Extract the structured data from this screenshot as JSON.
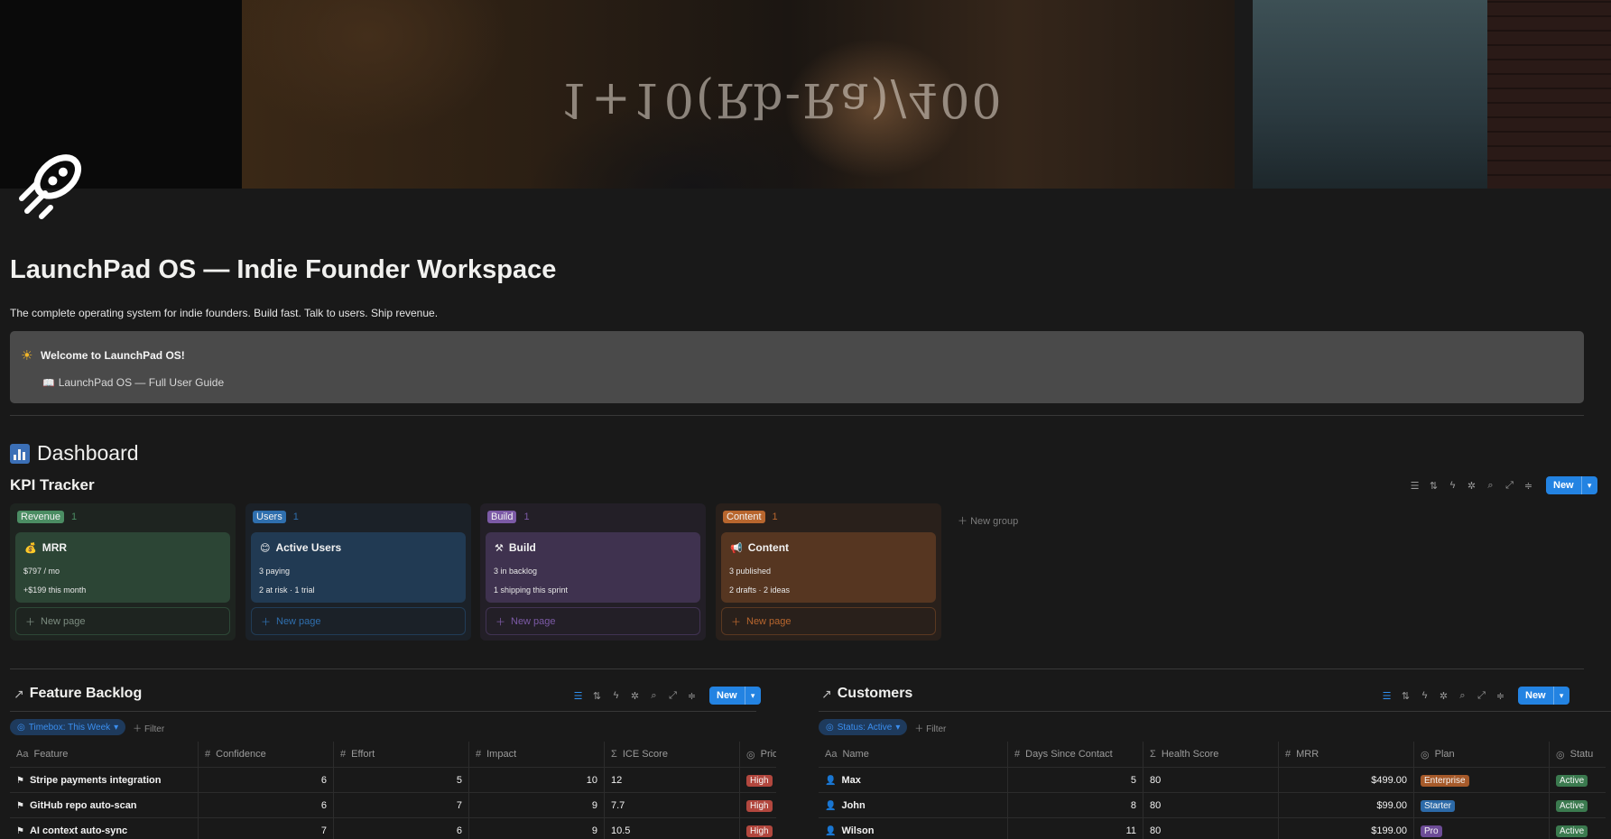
{
  "page": {
    "title": "LaunchPad OS — Indie Founder Workspace",
    "subtitle": "The complete operating system for indie founders. Build fast. Talk to users. Ship revenue.",
    "icon": "rocket-icon"
  },
  "cover": {
    "equation": "1+10(Rb-Ra)/400"
  },
  "callout": {
    "icon": "sun-icon",
    "title": "Welcome to LaunchPad OS!",
    "link_icon": "book-icon",
    "link_text": "LaunchPad OS — Full User Guide"
  },
  "dashboard": {
    "heading": "Dashboard",
    "icon": "bar-chart-icon"
  },
  "kpi": {
    "title": "KPI Tracker",
    "new_label": "New",
    "new_group_label": "New group",
    "columns": [
      {
        "tag": "Revenue",
        "count": "1",
        "accent": "#4b8d63",
        "card_icon": "money-bag-icon",
        "card_glyph": "💰",
        "card_title": "MRR",
        "line1": "$797 / mo",
        "line2": "+$199 this month",
        "new_page": "New page"
      },
      {
        "tag": "Users",
        "count": "1",
        "accent": "#2f6fae",
        "card_icon": "smiley-icon",
        "card_glyph": "😊",
        "card_title": "Active Users",
        "line1": "3 paying",
        "line2": "2 at risk · 1 trial",
        "new_page": "New page"
      },
      {
        "tag": "Build",
        "count": "1",
        "accent": "#7c5aa6",
        "card_icon": "tools-icon",
        "card_glyph": "⚒",
        "card_title": "Build",
        "line1": "3 in backlog",
        "line2": "1 shipping this sprint",
        "new_page": "New page"
      },
      {
        "tag": "Content",
        "count": "1",
        "accent": "#b8662e",
        "card_icon": "megaphone-icon",
        "card_glyph": "📢",
        "card_title": "Content",
        "line1": "3 published",
        "line2": "2 drafts · 2 ideas",
        "new_page": "New page"
      }
    ]
  },
  "feature_backlog": {
    "title": "Feature Backlog",
    "new_label": "New",
    "filter_chip": "Timebox: This Week",
    "add_filter": "Filter",
    "columns": [
      "Feature",
      "Confidence",
      "Effort",
      "Impact",
      "ICE Score",
      "Prior"
    ],
    "column_icons": [
      "Aa",
      "#",
      "#",
      "#",
      "Σ",
      "◎"
    ],
    "rows": [
      {
        "feature": "Stripe payments integration",
        "confidence": "6",
        "effort": "5",
        "impact": "10",
        "ice": "12",
        "priority": "High"
      },
      {
        "feature": "GitHub repo auto-scan",
        "confidence": "6",
        "effort": "7",
        "impact": "9",
        "ice": "7.7",
        "priority": "High"
      },
      {
        "feature": "AI context auto-sync",
        "confidence": "7",
        "effort": "6",
        "impact": "9",
        "ice": "10.5",
        "priority": "High"
      }
    ]
  },
  "customers": {
    "title": "Customers",
    "new_label": "New",
    "filter_chip": "Status: Active",
    "add_filter": "Filter",
    "columns": [
      "Name",
      "Days Since Contact",
      "Health Score",
      "MRR",
      "Plan",
      "Statu"
    ],
    "column_icons": [
      "Aa",
      "#",
      "Σ",
      "#",
      "◎",
      "◎"
    ],
    "rows": [
      {
        "name": "Max",
        "days": "5",
        "health": "80",
        "mrr": "$499.00",
        "plan": "Enterprise",
        "plan_color": "#a65a2a",
        "status": "Active"
      },
      {
        "name": "John",
        "days": "8",
        "health": "80",
        "mrr": "$99.00",
        "plan": "Starter",
        "plan_color": "#2c6aa8",
        "status": "Active"
      },
      {
        "name": "Wilson",
        "days": "11",
        "health": "80",
        "mrr": "$199.00",
        "plan": "Pro",
        "plan_color": "#6d4c97",
        "status": "Active"
      }
    ]
  },
  "colors": {
    "priority_high": "#b2473e",
    "status_active": "#3b7a4f",
    "accent_blue": "#2383e2"
  }
}
